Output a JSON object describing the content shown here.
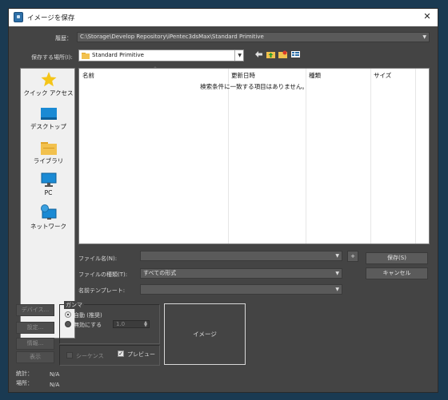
{
  "window": {
    "title": "イメージを保存",
    "close_glyph": "✕"
  },
  "history": {
    "label": "履歴：",
    "value": "C:\\Storage\\Develop Repository\\iPentec3dsMax\\Standard Primitive"
  },
  "save_in": {
    "label": "保存する場所(I):",
    "value": "Standard Primitive"
  },
  "places": [
    {
      "label": "クイック アクセス",
      "icon": "star-icon"
    },
    {
      "label": "デスクトップ",
      "icon": "desktop-icon"
    },
    {
      "label": "ライブラリ",
      "icon": "library-icon"
    },
    {
      "label": "PC",
      "icon": "pc-icon"
    },
    {
      "label": "ネットワーク",
      "icon": "network-icon"
    }
  ],
  "list": {
    "columns": [
      "名前",
      "更新日時",
      "種類",
      "サイズ"
    ],
    "empty_message": "検索条件に一致する項目はありません。"
  },
  "form": {
    "filename_label": "ファイル名(N):",
    "filename_value": "",
    "filetype_label": "ファイルの種類(T):",
    "filetype_value": "すべての形式",
    "template_label": "名前テンプレート:",
    "template_value": "",
    "plus_label": "+",
    "save_label": "保存(S)",
    "cancel_label": "キャンセル"
  },
  "side_buttons": [
    "デバイス...",
    "設定...",
    "情報...",
    "表示"
  ],
  "gamma": {
    "title": "ガンマ",
    "auto_label": "自動 (推奨)",
    "override_label": "無効にする",
    "override_value": "1.0"
  },
  "sequence_label": "シーケンス",
  "preview_check_label": "プレビュー",
  "preview_text": "イメージ",
  "stats": {
    "stats_label": "統計：",
    "stats_value": "N/A",
    "location_label": "場所：",
    "location_value": "N/A"
  },
  "colors": {
    "background": "#444444",
    "title_bar": "#ffffff",
    "list_bg": "#ffffff",
    "accent_blue": "#2d6fa8"
  }
}
